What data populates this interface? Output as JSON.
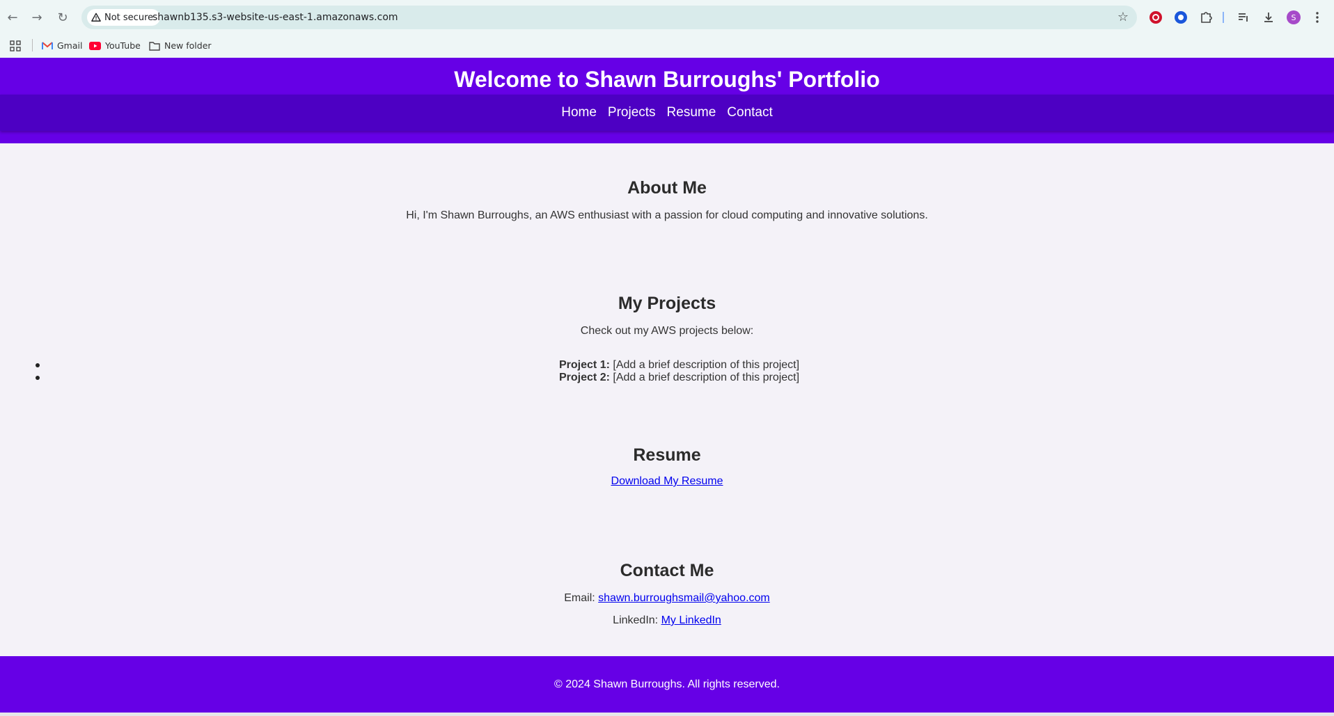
{
  "browser": {
    "security_label": "Not secure",
    "url": "shawnb135.s3-website-us-east-1.amazonaws.com",
    "bookmarks": [
      "Gmail",
      "YouTube",
      "New folder"
    ],
    "profile_initial": "S",
    "colors": {
      "chrome_bg": "#eef6f6",
      "omnibox_bg": "#d9ebeb"
    }
  },
  "site": {
    "title": "Welcome to Shawn Burroughs' Portfolio",
    "nav": [
      "Home",
      "Projects",
      "Resume",
      "Contact"
    ],
    "colors": {
      "header": "#6600e6",
      "nav": "#4d00c3",
      "link": "#0000ee"
    }
  },
  "about": {
    "heading": "About Me",
    "text": "Hi, I'm Shawn Burroughs, an AWS enthusiast with a passion for cloud computing and innovative solutions."
  },
  "projects": {
    "heading": "My Projects",
    "intro": "Check out my AWS projects below:",
    "items": [
      {
        "label": "Project 1:",
        "desc": "[Add a brief description of this project]"
      },
      {
        "label": "Project 2:",
        "desc": "[Add a brief description of this project]"
      }
    ]
  },
  "resume": {
    "heading": "Resume",
    "link_text": "Download My Resume"
  },
  "contact": {
    "heading": "Contact Me",
    "email_label": "Email:",
    "email": "shawn.burroughsmail@yahoo.com",
    "linkedin_label": "LinkedIn:",
    "linkedin_text": "My LinkedIn"
  },
  "footer": {
    "text": "© 2024 Shawn Burroughs. All rights reserved."
  }
}
